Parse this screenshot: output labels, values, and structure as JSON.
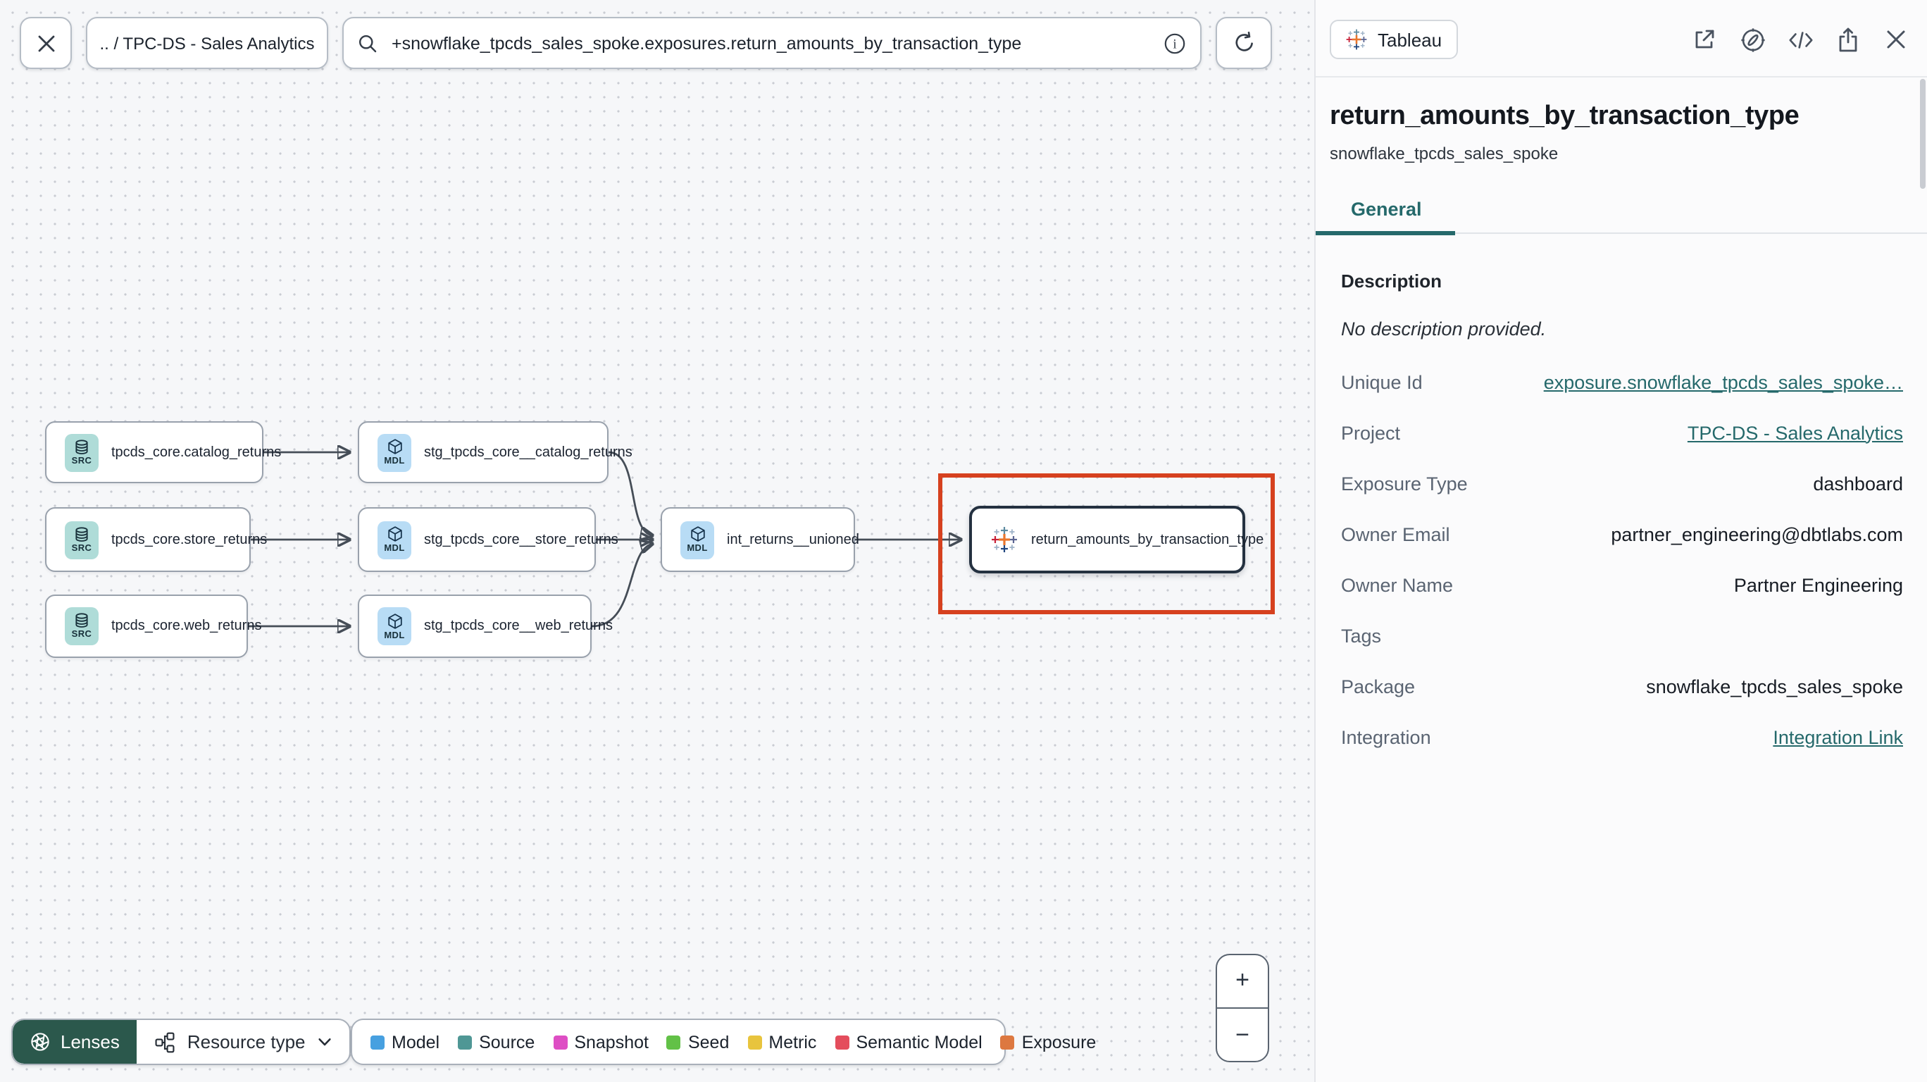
{
  "topbar": {
    "breadcrumb": ".. / TPC-DS - Sales Analytics",
    "search": {
      "value": "+snowflake_tpcds_sales_spoke.exposures.return_amounts_by_transaction_type"
    }
  },
  "graph": {
    "nodes": [
      {
        "badge": "SRC",
        "label": "tpcds_core.catalog_returns"
      },
      {
        "badge": "SRC",
        "label": "tpcds_core.store_returns"
      },
      {
        "badge": "SRC",
        "label": "tpcds_core.web_returns"
      },
      {
        "badge": "MDL",
        "label": "stg_tpcds_core__catalog_returns"
      },
      {
        "badge": "MDL",
        "label": "stg_tpcds_core__store_returns"
      },
      {
        "badge": "MDL",
        "label": "stg_tpcds_core__web_returns"
      },
      {
        "badge": "MDL",
        "label": "int_returns__unioned"
      },
      {
        "label": "return_amounts_by_transaction_type"
      }
    ]
  },
  "controls": {
    "lenses_label": "Lenses",
    "resource_type_label": "Resource type",
    "zoom_in": "+",
    "zoom_out": "−"
  },
  "legend": {
    "items": [
      {
        "label": "Model",
        "color": "#47a0e0"
      },
      {
        "label": "Source",
        "color": "#4f9795"
      },
      {
        "label": "Snapshot",
        "color": "#de4ec4"
      },
      {
        "label": "Seed",
        "color": "#62c147"
      },
      {
        "label": "Metric",
        "color": "#e8c43d"
      },
      {
        "label": "Semantic Model",
        "color": "#e44d5c"
      },
      {
        "label": "Exposure",
        "color": "#dd7840"
      }
    ]
  },
  "panel": {
    "source_badge": "Tableau",
    "title": "return_amounts_by_transaction_type",
    "subtitle": "snowflake_tpcds_sales_spoke",
    "tabs": [
      {
        "label": "General"
      }
    ],
    "description_label": "Description",
    "description_empty": "No description provided.",
    "rows": [
      {
        "label": "Unique Id",
        "value": "exposure.snowflake_tpcds_sales_spoke…"
      },
      {
        "label": "Project",
        "value": "TPC-DS - Sales Analytics"
      },
      {
        "label": "Exposure Type",
        "value": "dashboard"
      },
      {
        "label": "Owner Email",
        "value": "partner_engineering@dbtlabs.com"
      },
      {
        "label": "Owner Name",
        "value": "Partner Engineering"
      },
      {
        "label": "Tags",
        "value": ""
      },
      {
        "label": "Package",
        "value": "snowflake_tpcds_sales_spoke"
      },
      {
        "label": "Integration",
        "value": "Integration Link"
      }
    ]
  },
  "colors": {
    "accent_teal": "#25696b",
    "highlight_red": "#d6411f",
    "lenses_green": "#2b584c",
    "source_icon_bg": "#afdcd8",
    "model_icon_bg": "#b8dcf5"
  }
}
